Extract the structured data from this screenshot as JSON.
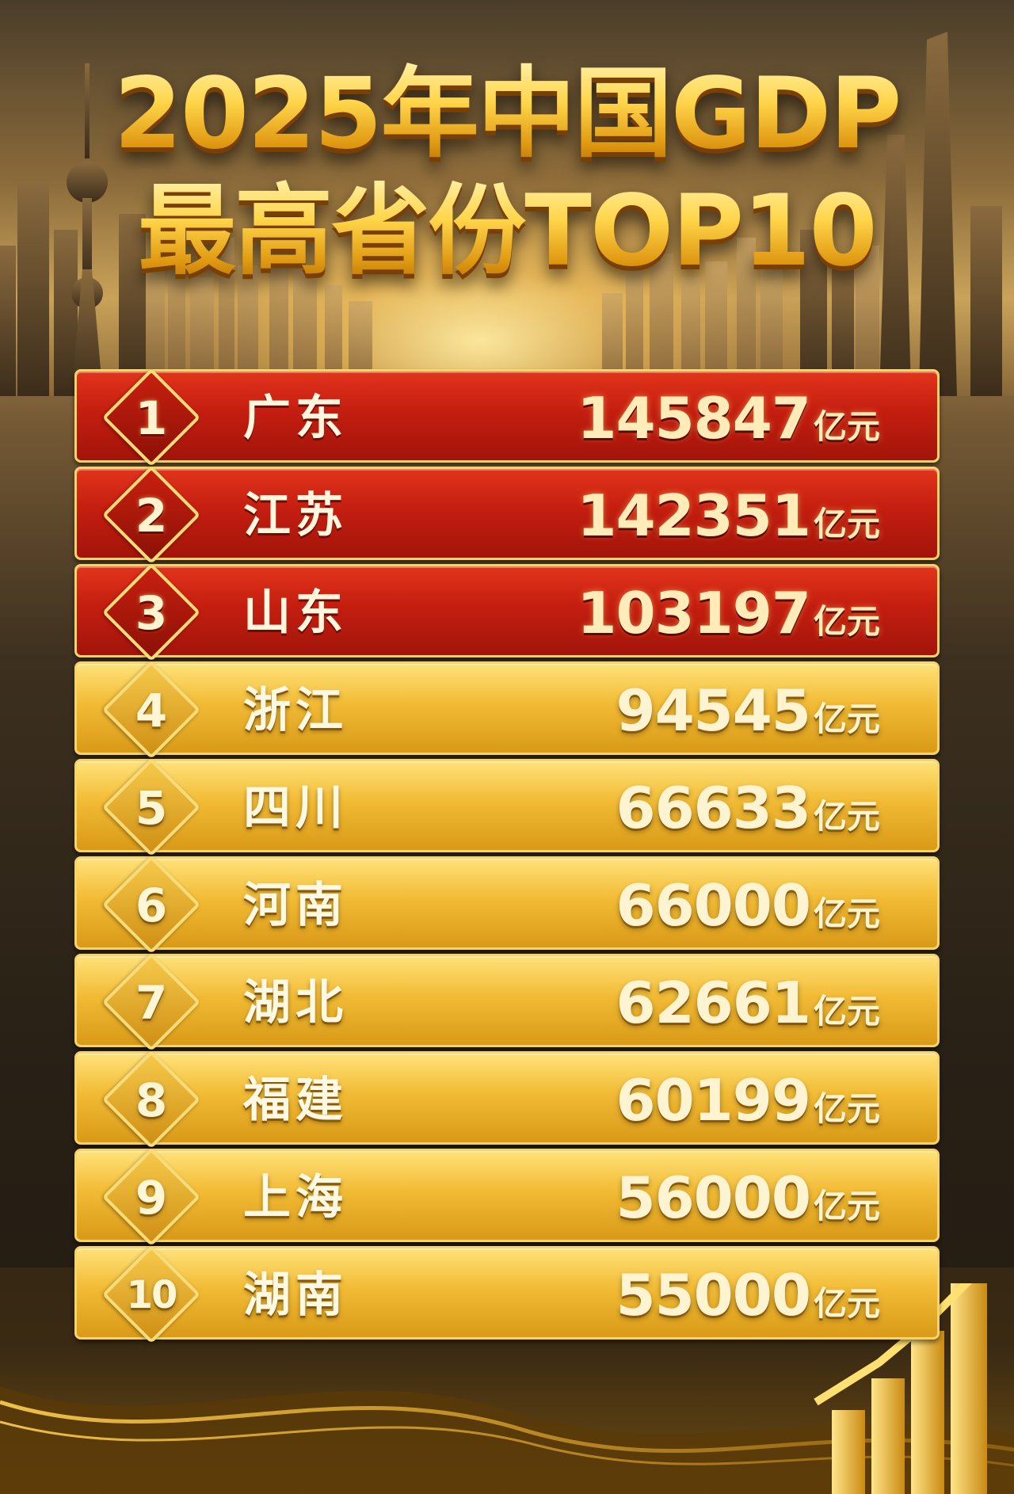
{
  "title": {
    "line1": "2025年中国GDP",
    "line2": "最高省份TOP10"
  },
  "unit": "亿元",
  "colors": {
    "top3_row": "#c41e10",
    "other_row": "#f2bb35",
    "title_gold": "#ffd24a"
  },
  "rows": [
    {
      "rank": "1",
      "province": "广东",
      "value": "145847",
      "unit": "亿元"
    },
    {
      "rank": "2",
      "province": "江苏",
      "value": "142351",
      "unit": "亿元"
    },
    {
      "rank": "3",
      "province": "山东",
      "value": "103197",
      "unit": "亿元"
    },
    {
      "rank": "4",
      "province": "浙江",
      "value": "94545",
      "unit": "亿元"
    },
    {
      "rank": "5",
      "province": "四川",
      "value": "66633",
      "unit": "亿元"
    },
    {
      "rank": "6",
      "province": "河南",
      "value": "66000",
      "unit": "亿元"
    },
    {
      "rank": "7",
      "province": "湖北",
      "value": "62661",
      "unit": "亿元"
    },
    {
      "rank": "8",
      "province": "福建",
      "value": "60199",
      "unit": "亿元"
    },
    {
      "rank": "9",
      "province": "上海",
      "value": "56000",
      "unit": "亿元"
    },
    {
      "rank": "10",
      "province": "湖南",
      "value": "55000",
      "unit": "亿元"
    }
  ],
  "icons": {
    "skyline": "city-skyline-icon",
    "rank_badge": "diamond-badge-icon",
    "growth": "growth-arrow-bars-icon"
  }
}
